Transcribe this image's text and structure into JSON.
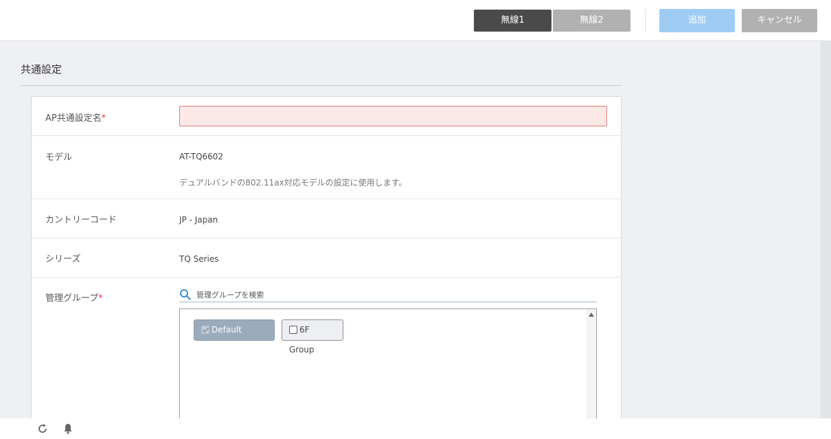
{
  "toolbar": {
    "tab_wireless1": "無線1",
    "tab_wireless2": "無線2",
    "add_label": "追加",
    "cancel_label": "キャンセル"
  },
  "section": {
    "title": "共通設定"
  },
  "form": {
    "name": {
      "label": "AP共通設定名",
      "required_mark": "*",
      "value": ""
    },
    "model": {
      "label": "モデル",
      "value": "AT-TQ6602",
      "description": "デュアルバンドの802.11ax対応モデルの設定に使用します。"
    },
    "country": {
      "label": "カントリーコード",
      "value": "JP - Japan"
    },
    "series": {
      "label": "シリーズ",
      "value": "TQ Series"
    },
    "group": {
      "label": "管理グループ",
      "required_mark": "*",
      "search_placeholder": "管理グループを検索",
      "items": [
        {
          "label": "Default Group",
          "checked": true,
          "disabled": true
        },
        {
          "label": "6F Group",
          "checked": false,
          "disabled": false
        }
      ]
    }
  },
  "footer": {
    "icons": [
      "refresh-icon",
      "bell-icon"
    ]
  },
  "colors": {
    "primary_disabled": "#9fccf5",
    "active_tab": "#4a4a4a",
    "inactive": "#b1b1b1",
    "error_bg": "#fde8e8",
    "required": "#e0383e"
  }
}
